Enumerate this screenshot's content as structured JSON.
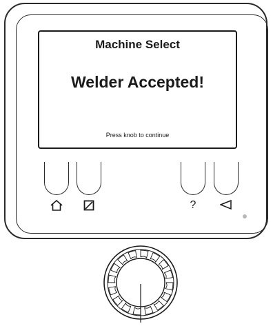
{
  "screen": {
    "title": "Machine Select",
    "message": "Welder Accepted!",
    "hint": "Press knob to continue"
  },
  "soft_keys": [
    {
      "icon": "home-icon"
    },
    {
      "icon": "square-slash-icon"
    },
    {
      "label": "?",
      "icon": "question-icon"
    },
    {
      "icon": "back-triangle-icon"
    }
  ],
  "knob": {
    "icon": "control-knob"
  }
}
